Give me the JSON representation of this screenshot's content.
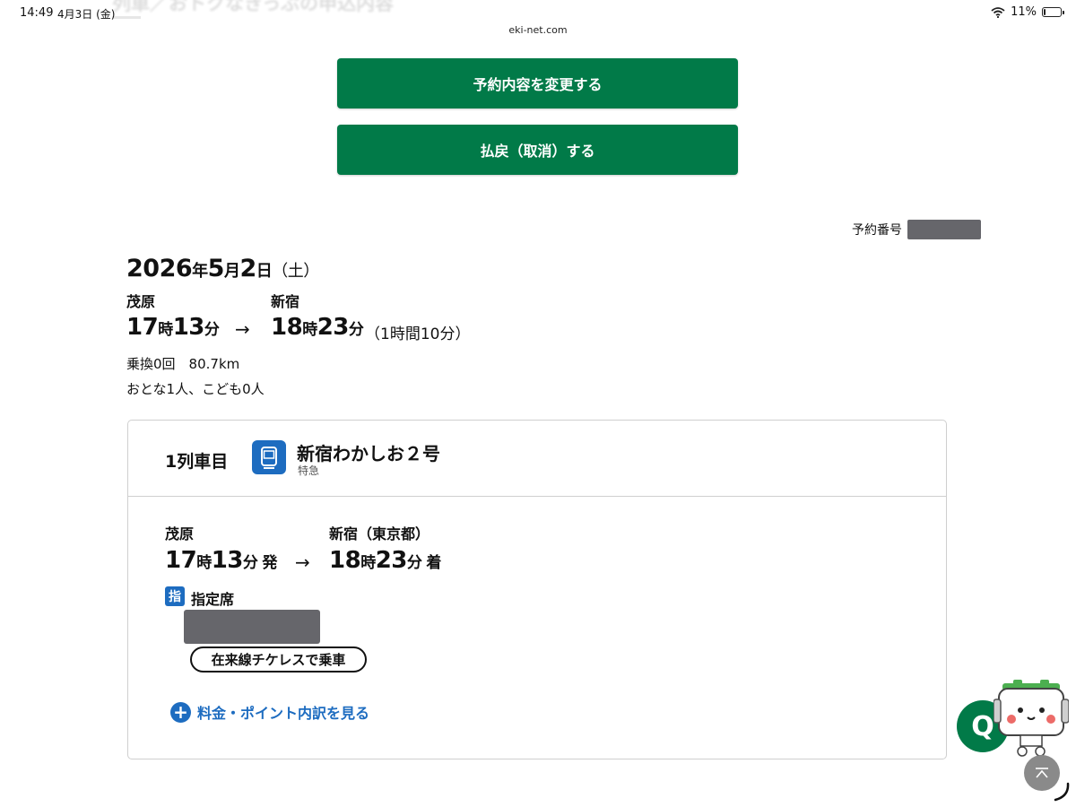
{
  "status_bar": {
    "time": "14:49",
    "date": "4月3日 (金)",
    "battery": "11%",
    "battery_level": 0.11
  },
  "page_header": {
    "title": "列車／おトクなきっぷの申込内容"
  },
  "url": "eki-net.com",
  "buttons": {
    "change": "予約内容を変更する",
    "refund": "払戻（取消）する"
  },
  "reservation": {
    "number_label": "予約番号"
  },
  "trip": {
    "date": {
      "year": "2026",
      "year_unit": "年",
      "month": "5",
      "month_unit": "月",
      "day": "2",
      "day_unit": "日",
      "weekday": "（土）"
    },
    "from_station": "茂原",
    "to_station": "新宿",
    "depart": {
      "hour": "17",
      "hour_unit": "時",
      "minute": "13",
      "minute_unit": "分"
    },
    "arrow": "→",
    "arrive": {
      "hour": "18",
      "hour_unit": "時",
      "minute": "23",
      "minute_unit": "分"
    },
    "duration": "（1時間10分）",
    "transfers": "乗換0回　80.7km",
    "passengers": "おとな1人、こども0人"
  },
  "train_card": {
    "index_label": "1列車目",
    "train_name": "新宿わかしお２号",
    "train_type": "特急",
    "from_station": "茂原",
    "to_station": "新宿（東京都）",
    "depart": {
      "hour": "17",
      "hour_unit": "時",
      "minute": "13",
      "minute_unit": "分",
      "suffix": "発"
    },
    "arrive": {
      "hour": "18",
      "hour_unit": "時",
      "minute": "23",
      "minute_unit": "分",
      "suffix": "着"
    },
    "arrow": "→",
    "seat_badge": "指",
    "seat_type": "指定席",
    "ticketless": "在来線チケレスで乗車",
    "breakdown_link": "料金・ポイント内訳を見る"
  },
  "floating": {
    "q_label": "Q"
  },
  "icons": {
    "wifi": "wifi-icon",
    "battery": "battery-icon",
    "train": "train-icon",
    "plus": "plus-circle-icon",
    "scroll_top": "chevron-up-icon",
    "mascot": "mascot-icon"
  },
  "colors": {
    "primary_green": "#017a48",
    "link_blue": "#1d6cc0",
    "redacted_gray": "#66666b"
  }
}
